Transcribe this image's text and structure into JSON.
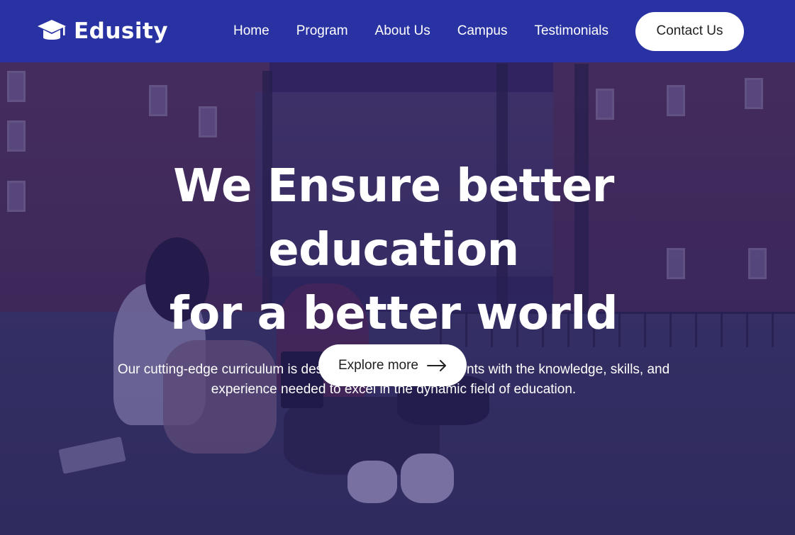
{
  "brand": {
    "name": "Edusity",
    "icon": "graduation-cap-icon"
  },
  "nav": {
    "items": [
      "Home",
      "Program",
      "About Us",
      "Campus",
      "Testimonials"
    ],
    "cta_label": "Contact Us"
  },
  "hero": {
    "title_line1": "We Ensure better education",
    "title_line2": "for a better world",
    "subtitle": "Our cutting-edge curriculum is designed to empower students with the knowledge, skills, and experience needed to excel in the dynamic field of education.",
    "button_label": "Explore more",
    "button_icon": "arrow-right-icon"
  },
  "colors": {
    "navbar": "#2832a2",
    "overlay": "#261e69",
    "text_light": "#ffffff",
    "button_bg": "#ffffff",
    "button_text": "#212121"
  }
}
